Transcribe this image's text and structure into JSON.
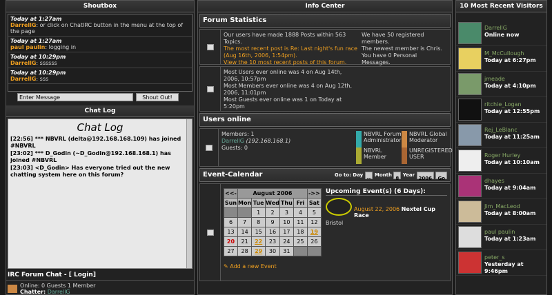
{
  "shoutbox": {
    "title": "Shoutbox",
    "messages": [
      {
        "time": "Today at 1:27am",
        "user": "DarrellG",
        "text": ": or click on ChatIRC button in the menu at the top of the page"
      },
      {
        "time": "Today at 1:27am",
        "user": "paul paulin",
        "text": ": logging in"
      },
      {
        "time": "Today at 10:29pm",
        "user": "DarrellG",
        "text": ": ssssss"
      },
      {
        "time": "Today at 10:29pm",
        "user": "DarrellG",
        "text": ": sss"
      }
    ],
    "input_placeholder": "Enter Message",
    "submit_label": "Shout Out!"
  },
  "chatlog": {
    "title": "Chat Log",
    "heading": "Chat Log",
    "lines": [
      "[22:56] *** NBVRL (delta@192.168.168.109) has joined #NBVRL",
      "[23:02] *** D_Godin (~D_Godin@192.168.168.1) has joined #NBVRL",
      "[23:03] <D_Godin> Has everyone tried out the new chatting system here on this forum?"
    ]
  },
  "irc": {
    "title": "IRC Forum Chat - [ Login]",
    "online": "Online: 0 Guests 1 Member",
    "chatter_label": "Chatter:",
    "chatter_name": "DarrellG"
  },
  "info_center": {
    "title": "Info Center",
    "forum_stats_title": "Forum Statistics",
    "stats_a": "Our users have made 1888 Posts within 563 Topics.",
    "stats_b": "The most recent post is Re: Last night's fun race (Aug 16th, 2006, 1:54pm).",
    "stats_c": "View the 10 most recent posts of this forum.",
    "stats_right_a": "We have 50 registered members.",
    "stats_right_b": "The newest member is Chris.",
    "stats_right_c": "You have 0 Personal Messages.",
    "most_users": "Most Users ever online was 4 on Aug 14th, 2006, 10:57pm",
    "most_members": "Most Members ever online was 4 on Aug 12th, 2006, 11:01pm",
    "most_guests": "Most Guests ever online was 1 on Today at 5:20pm",
    "users_online_title": "Users online",
    "members_line": "Members: 1",
    "member_name": "DarrellG",
    "member_ip": "(192.168.168.1)",
    "guests_line": "Guests: 0",
    "legend": [
      "NBVRL Forum Administrator",
      "NBVRL Global Moderator",
      "NBVRL Member",
      "UNREGISTERED USER"
    ]
  },
  "calendar": {
    "title": "Event-Calendar",
    "goto_label": "Go to: Day",
    "day_value": "--",
    "month_label": "Month",
    "month_value": "8",
    "year_label": "Year",
    "year_value": "2006",
    "go_label": "Go",
    "prev": "<<-",
    "next": "->>",
    "month_title": "August 2006",
    "weekdays": [
      "Sun",
      "Mon",
      "Tue",
      "Wed",
      "Thu",
      "Fri",
      "Sat"
    ],
    "upcoming_title": "Upcoming Event(s) (6 Days):",
    "event_date": "August 22, 2006",
    "event_name": "Nextel Cup Race",
    "event_location": "Bristol",
    "add_event": "Add a new Event"
  },
  "visitors": {
    "title": "10 Most Recent Visitors",
    "list": [
      {
        "name": "DarrellG",
        "time": "Online now",
        "color": "#4a8a6a"
      },
      {
        "name": "M_McCullough",
        "time": "Today at 6:27pm",
        "color": "#e8d060"
      },
      {
        "name": "jmeade",
        "time": "Today at 4:10pm",
        "color": "#7a9a6a"
      },
      {
        "name": "ritchie_Logan",
        "time": "Today at 12:55pm",
        "color": "#111111"
      },
      {
        "name": "Rej_LeBlanc",
        "time": "Today at 11:25am",
        "color": "#8899aa"
      },
      {
        "name": "Roger Hurley",
        "time": "Today at 10:10am",
        "color": "#eeeeee"
      },
      {
        "name": "dhayes",
        "time": "Today at 9:04am",
        "color": "#aa3377"
      },
      {
        "name": "Jim_MacLeod",
        "time": "Today at 8:00am",
        "color": "#ccbb99"
      },
      {
        "name": "paul paulin",
        "time": "Today at 1:23am",
        "color": "#dddddd"
      },
      {
        "name": "peter_s",
        "time": "Yesterday at 9:46pm",
        "color": "#cc3333"
      }
    ]
  }
}
